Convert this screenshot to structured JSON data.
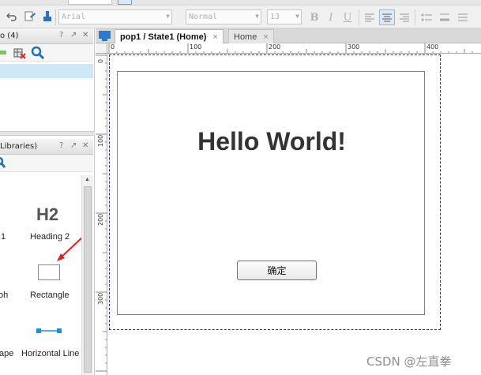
{
  "toolbar": {
    "font_family": "Arial",
    "font_style": "Normal",
    "font_size": "13",
    "bold": "B",
    "italic": "I",
    "underline": "U"
  },
  "left_top_pane": {
    "title": "o (4)"
  },
  "left_bottom_pane": {
    "title": "Libraries)"
  },
  "pane_controls": {
    "help": "?",
    "float": "↗",
    "close": "✕"
  },
  "library": {
    "h2_preview": "H2",
    "items": [
      "1",
      "Heading 2",
      "oh",
      "Rectangle",
      "ape",
      "Horizontal Line"
    ]
  },
  "tabs": [
    {
      "label": "pop1 / State1 (Home)"
    },
    {
      "label": "Home"
    }
  ],
  "tab_close": "×",
  "ruler": {
    "horizontal": [
      "0",
      "100",
      "200",
      "300",
      "400"
    ],
    "vertical": [
      "0",
      "100",
      "200",
      "300"
    ]
  },
  "canvas": {
    "heading": "Hello World!",
    "button_label": "确定"
  },
  "watermark": "CSDN @左直拳",
  "colors": {
    "selection": "#cde8f6",
    "page_outline": "#2a2aa8",
    "arrow": "#e02020",
    "line_handle": "#1f8fd6"
  }
}
